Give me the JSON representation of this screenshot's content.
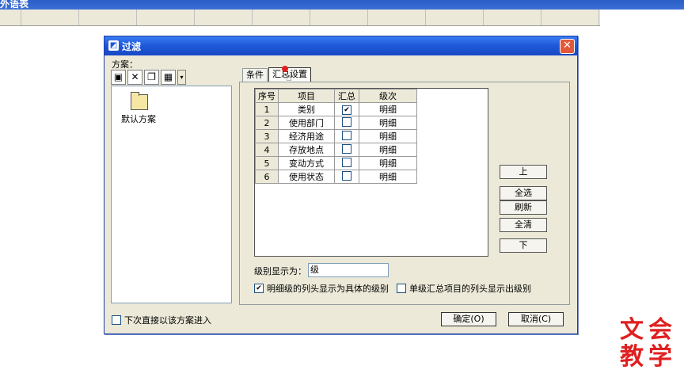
{
  "app": {
    "title": "外语表"
  },
  "dialog": {
    "title": "过滤",
    "close_icon": "close-icon",
    "scheme_label": "方案：",
    "toolbar_icons": [
      "save-icon",
      "delete-icon",
      "copy-icon",
      "grid-icon"
    ],
    "scheme_items": [
      {
        "label": "默认方案"
      }
    ],
    "direct_enter_label": "下次直接以该方案进入",
    "tabs": [
      {
        "label": "条件"
      },
      {
        "label": "汇总设置"
      }
    ],
    "table": {
      "headers": [
        "序号",
        "项目",
        "汇总",
        "级次"
      ],
      "rows": [
        {
          "seq": "1",
          "item": "类别",
          "checked": true,
          "level": "明细"
        },
        {
          "seq": "2",
          "item": "使用部门",
          "checked": false,
          "level": "明细"
        },
        {
          "seq": "3",
          "item": "经济用途",
          "checked": false,
          "level": "明细"
        },
        {
          "seq": "4",
          "item": "存放地点",
          "checked": false,
          "level": "明细"
        },
        {
          "seq": "5",
          "item": "变动方式",
          "checked": false,
          "level": "明细"
        },
        {
          "seq": "6",
          "item": "使用状态",
          "checked": false,
          "level": "明细"
        }
      ]
    },
    "buttons": {
      "up": "上",
      "select_all": "全选",
      "refresh": "刷新",
      "clear_all": "全清",
      "down": "下"
    },
    "level_display_label": "级别显示为：",
    "level_display_value": "级",
    "option_detail_label": "明细级的列头显示为具体的级别",
    "option_detail_checked": true,
    "option_single_label": "单级汇总项目的列头显示出级别",
    "option_single_checked": false,
    "ok_label": "确定(O)",
    "cancel_label": "取消(C)"
  },
  "watermark": [
    "文",
    "会",
    "教",
    "学"
  ],
  "colors": {
    "titlebar": "#1e57d8",
    "dialog_bg": "#ece9d8",
    "watermark": "#e02020"
  }
}
